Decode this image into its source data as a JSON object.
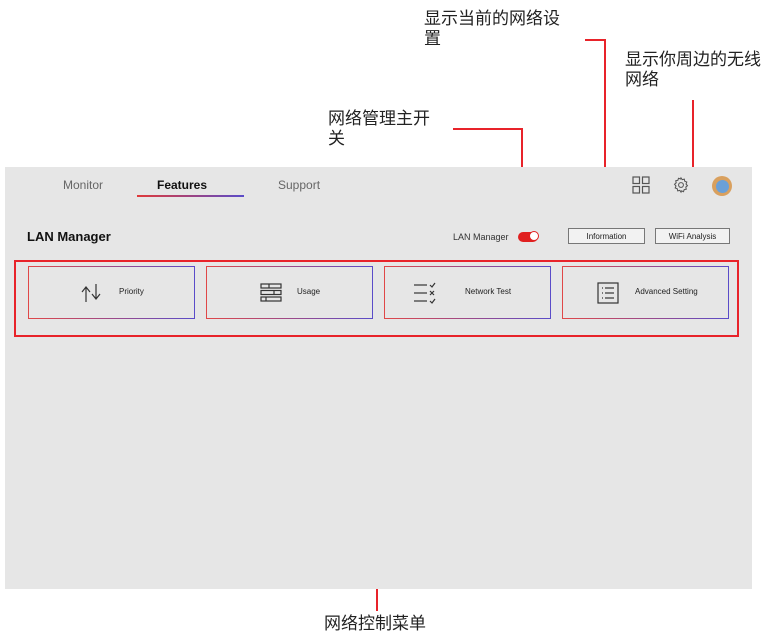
{
  "callouts": {
    "current_settings": "显示当前的网络设置",
    "nearby_wireless": "显示你周边的无线网络",
    "master_switch": "网络管理主开关",
    "control_menu": "网络控制菜单"
  },
  "tabs": [
    "Monitor",
    "Features",
    "Support"
  ],
  "active_tab": "Features",
  "page_title": "LAN Manager",
  "lan_manager_toggle": {
    "label": "LAN Manager",
    "state": "on"
  },
  "buttons": {
    "information": "Information",
    "wifi_analysis": "WiFi Analysis"
  },
  "features": [
    {
      "label": "Priority",
      "icon": "up-down-arrows-icon"
    },
    {
      "label": "Usage",
      "icon": "stacked-bars-icon"
    },
    {
      "label": "Network Test",
      "icon": "checklist-icon"
    },
    {
      "label": "Advanced Setting",
      "icon": "list-doc-icon"
    }
  ],
  "colors": {
    "accent_red": "#e8232a",
    "accent_purple": "#5a4cc9",
    "background": "#e6e6e6"
  }
}
